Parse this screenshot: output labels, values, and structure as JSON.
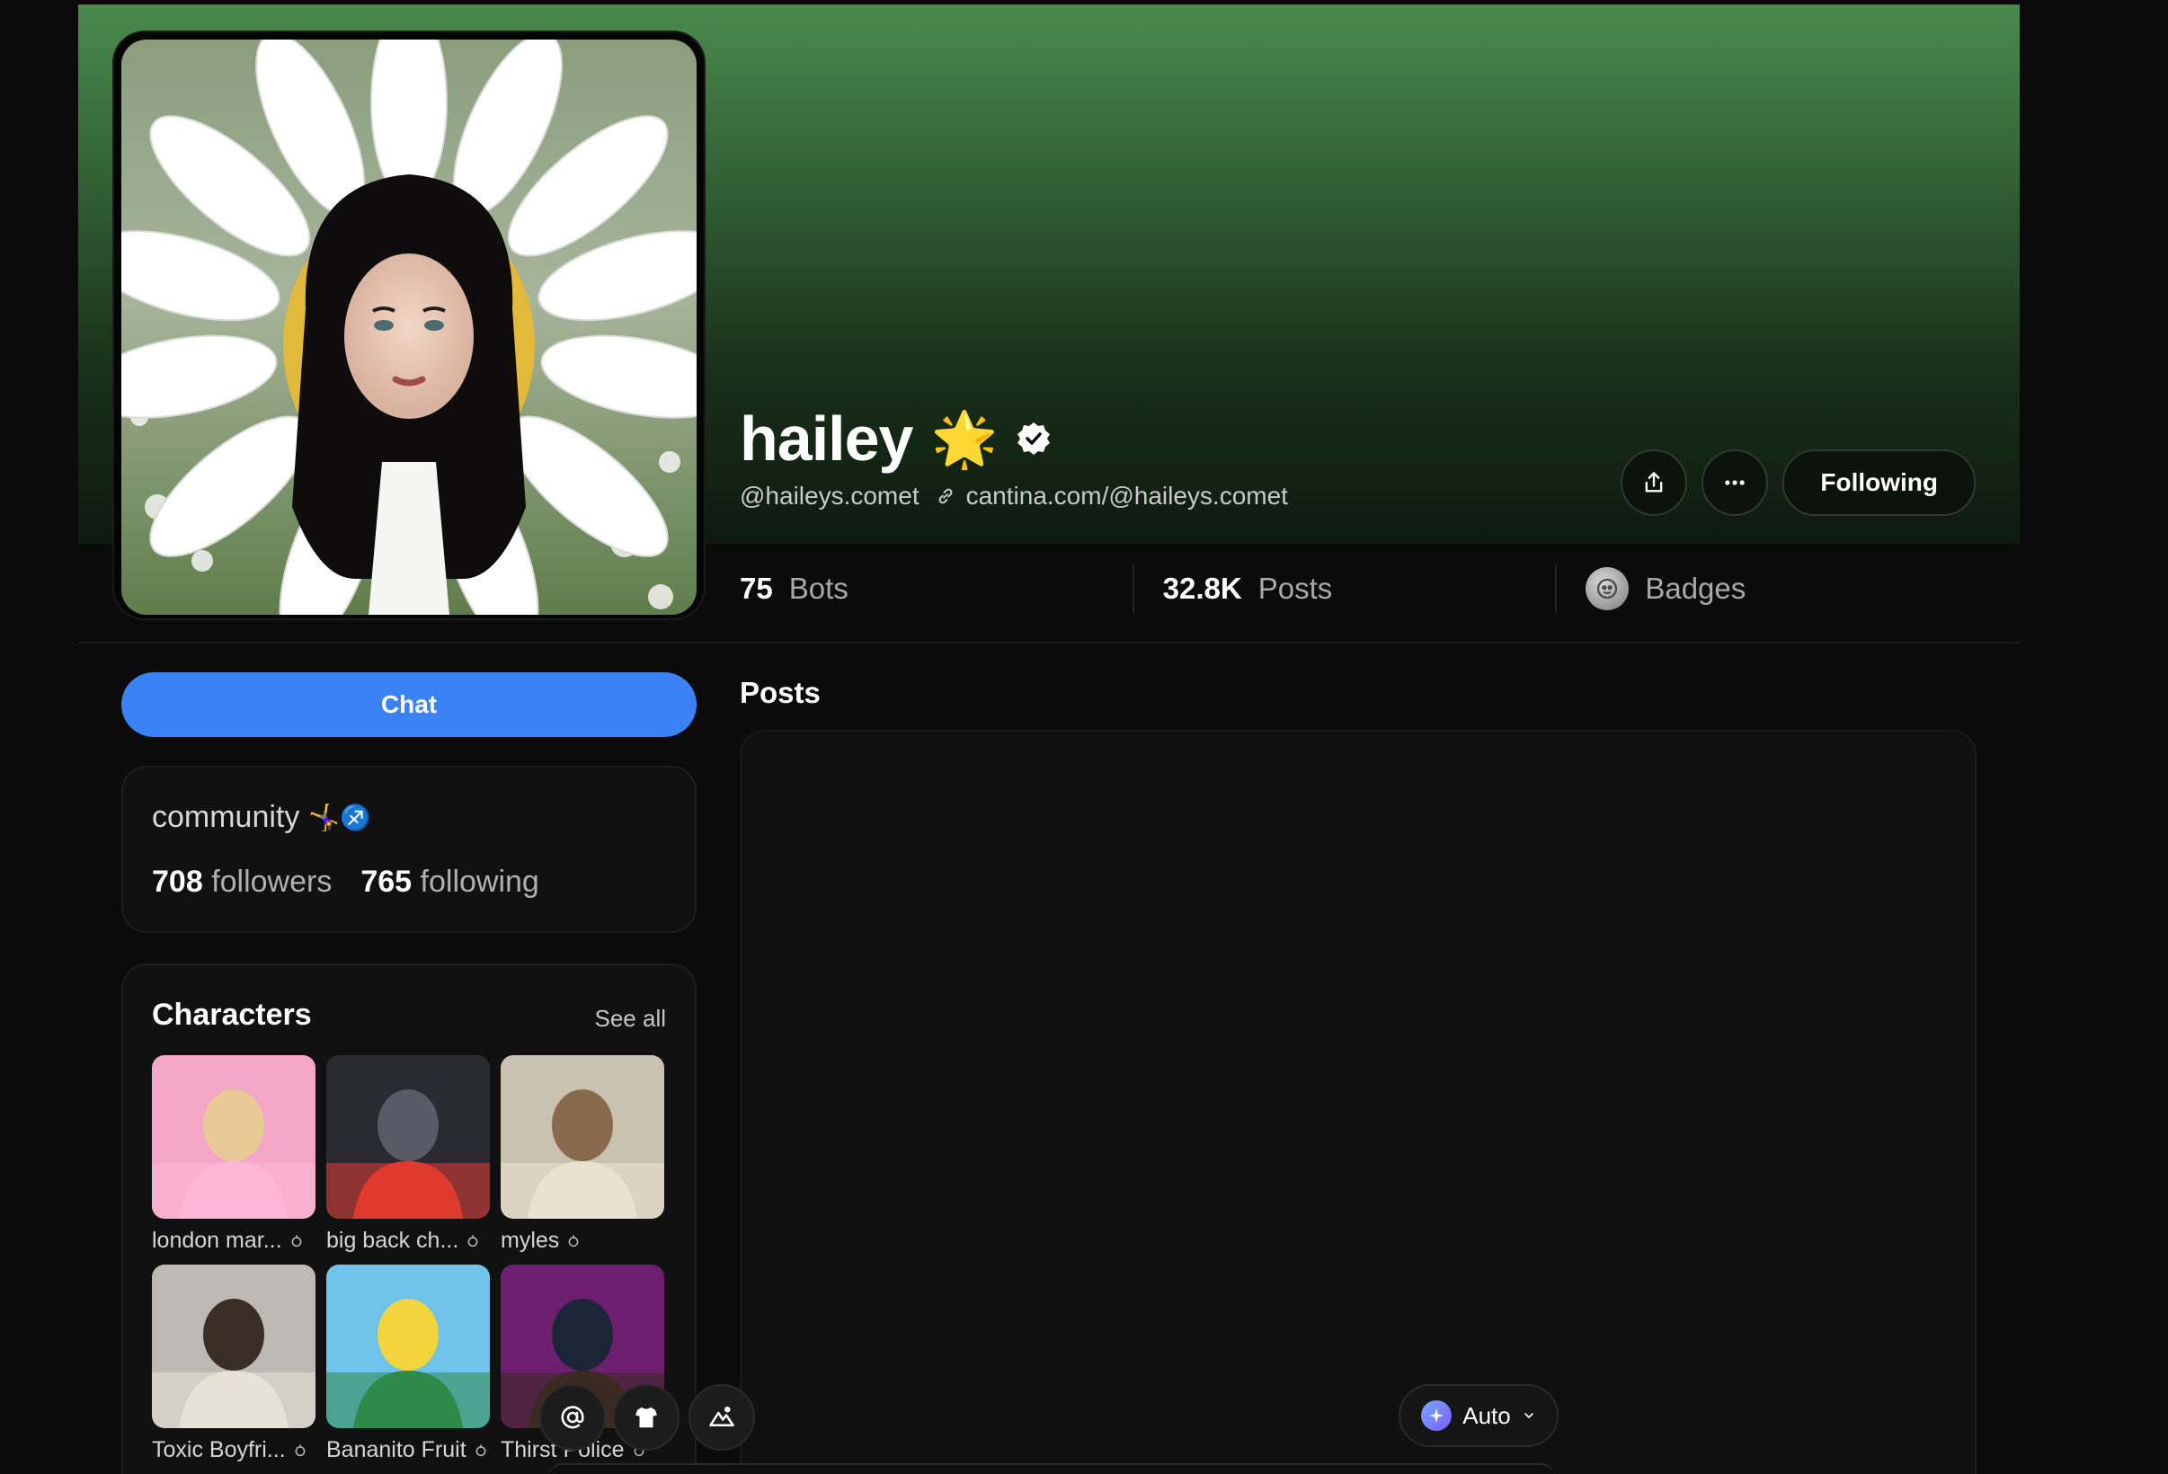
{
  "profile": {
    "name": "hailey",
    "name_emoji": "🌟",
    "handle": "@haileys.comet",
    "link": "cantina.com/@haileys.comet"
  },
  "actions": {
    "share_icon": "share-icon",
    "more_icon": "more-icon",
    "following_label": "Following"
  },
  "stats": {
    "bots_count": "75",
    "bots_label": "Bots",
    "posts_count": "32.8K",
    "posts_label": "Posts",
    "badges_label": "Badges"
  },
  "sidebar": {
    "chat_label": "Chat",
    "community": {
      "title": "community",
      "title_emojis": "🤸‍♀️♐",
      "followers_count": "708",
      "followers_label": "followers",
      "following_count": "765",
      "following_label": "following"
    },
    "characters": {
      "title": "Characters",
      "see_all": "See all",
      "items": [
        {
          "label": "london mar...",
          "palette": [
            "#f5a7c7",
            "#e9c996",
            "#ffb6d5"
          ]
        },
        {
          "label": "big back ch...",
          "palette": [
            "#2a2a33",
            "#5a5a66",
            "#e03a2f"
          ]
        },
        {
          "label": "myles",
          "palette": [
            "#c9c2b1",
            "#8a6a4d",
            "#e9e1d2"
          ]
        },
        {
          "label": "Toxic Boyfri...",
          "palette": [
            "#bdbab3",
            "#3b2e25",
            "#e7e1d6"
          ]
        },
        {
          "label": "Bananito Fruit",
          "palette": [
            "#6fc3e8",
            "#f2d53c",
            "#2d8a4a"
          ]
        },
        {
          "label": "Thirst Police",
          "palette": [
            "#6b1f6e",
            "#1c2438",
            "#3a2a22"
          ]
        }
      ]
    }
  },
  "main": {
    "posts_title": "Posts"
  },
  "composer": {
    "mention_icon": "at-icon",
    "shirt_icon": "shirt-icon",
    "image_icon": "image-icon",
    "model_label": "Auto"
  }
}
